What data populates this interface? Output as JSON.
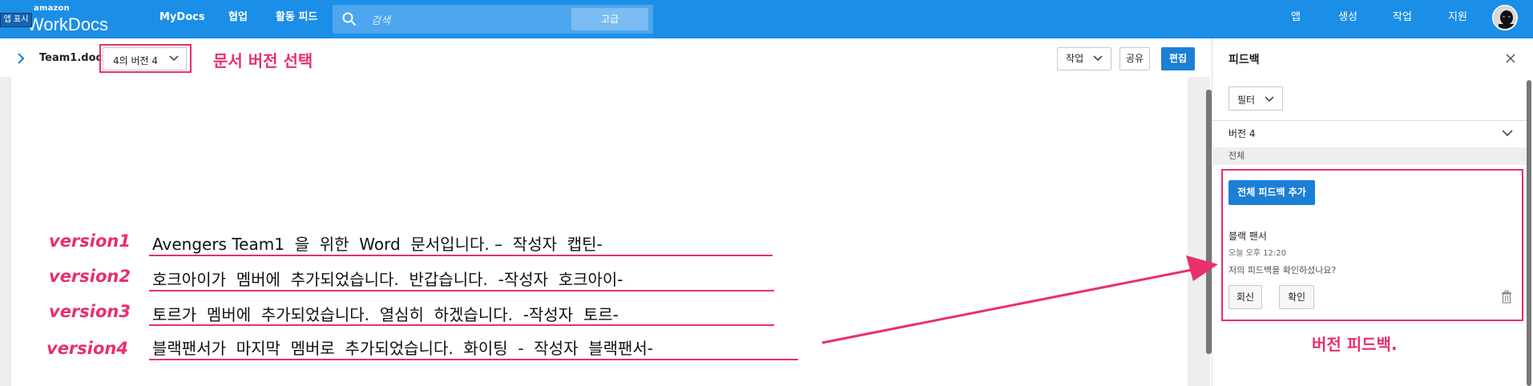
{
  "header": {
    "app_tag": "앱 표시",
    "logo_small": "amazon",
    "logo_big": "WorkDocs",
    "nav": [
      "MyDocs",
      "협업",
      "활동 피드"
    ],
    "search_placeholder": "검색",
    "advanced_label": "고급",
    "right_nav": [
      "앱",
      "생성",
      "작업",
      "지원"
    ]
  },
  "doc": {
    "name": "Team1.docx",
    "version_select": "4의 버전 4",
    "annotation_version_select": "문서 버전 선택",
    "actions": {
      "work_label": "작업",
      "share_label": "공유",
      "edit_label": "편집"
    },
    "lines": [
      {
        "label": "version1",
        "text": "Avengers Team1  을  위한  Word  문서입니다. –  작성자  캡틴-"
      },
      {
        "label": "version2",
        "text": "호크아이가  멤버에  추가되었습니다.  반갑습니다.  -작성자  호크아이-"
      },
      {
        "label": "version3",
        "text": "토르가  멤버에  추가되었습니다.  열심히  하겠습니다.  -작성자  토르-"
      },
      {
        "label": "version4",
        "text": "블랙팬서가  마지막  멤버로  추가되었습니다.  화이팅  -  작성자  블랙팬서-"
      }
    ]
  },
  "panel": {
    "title": "피드백",
    "filter_label": "필터",
    "version_label": "버전 4",
    "all_label": "전체",
    "add_feedback_label": "전체 피드백 추가",
    "author": "블랙 팬서",
    "time": "오늘 오후 12:20",
    "comment": "저의 피드백을 확인하셨나요?",
    "reply_label": "회신",
    "confirm_label": "확인",
    "annotation_feedback": "버전 피드백."
  },
  "colors": {
    "topbar": "#1b8ee8",
    "accent": "#1b7fd6",
    "annotation": "#e8306a"
  }
}
